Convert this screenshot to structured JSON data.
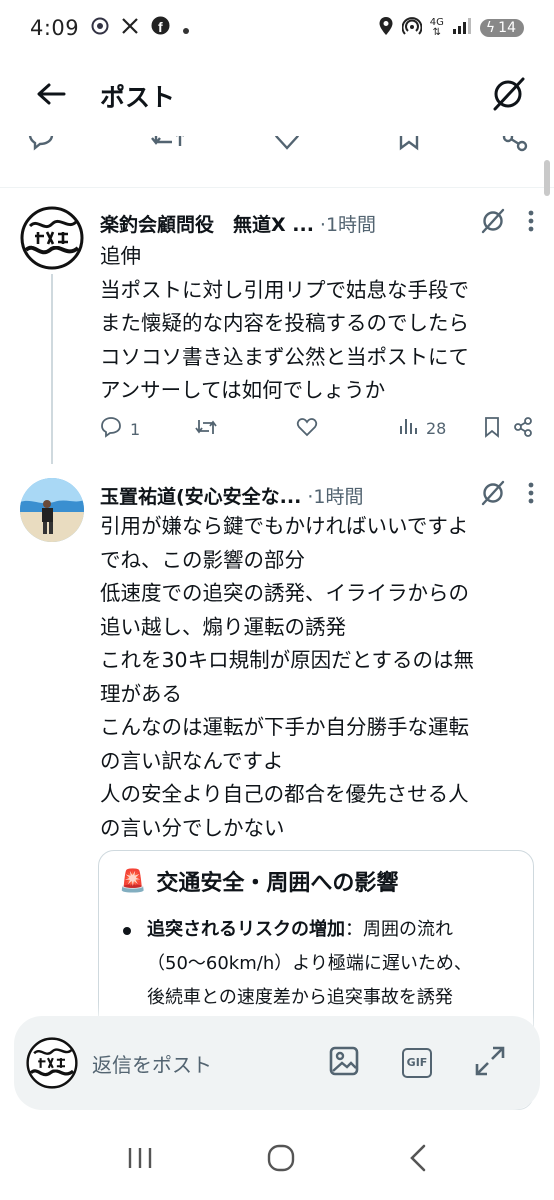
{
  "status_bar": {
    "time": "4:09",
    "battery": "14",
    "network": "4G"
  },
  "header": {
    "title": "ポスト"
  },
  "tweets": [
    {
      "name": "楽釣会顧問役　無道X ...",
      "time": "·1時間",
      "body": "追伸\n当ポストに対し引用リプで姑息な手段で\nまた懐疑的な内容を投稿するのでしたら\nコソコソ書き込まず公然と当ポストにて\nアンサーしては如何でしょうか",
      "replies": "1",
      "views": "28"
    },
    {
      "name": "玉置祐道(安心安全な...",
      "time": "·1時間",
      "body": "引用が嫌なら鍵でもかければいいですよ\nでね、この影響の部分\n低速度での追突の誘発、イライラからの\n追い越し、煽り運転の誘発\nこれを30キロ規制が原因だとするのは無\n理がある\nこんなのは運転が下手か自分勝手な運転\nの言い訳なんですよ\n人の安全より自己の都合を優先させる人\nの言い分でしかない"
    }
  ],
  "card": {
    "emoji": "🚨",
    "title": "交通安全・周囲への影響",
    "bullet_bold": "追突されるリスクの増加",
    "bullet_text": "：周囲の流れ\n（50〜60km/h）より極端に遅いため、\n後続車との速度差から追突事故を誘発\nしやすくなります"
  },
  "reply_bar": {
    "placeholder": "返信をポスト",
    "gif_label": "GIF"
  },
  "colors": {
    "text": "#0f1419",
    "muted": "#536471",
    "border": "#cfd9de"
  }
}
